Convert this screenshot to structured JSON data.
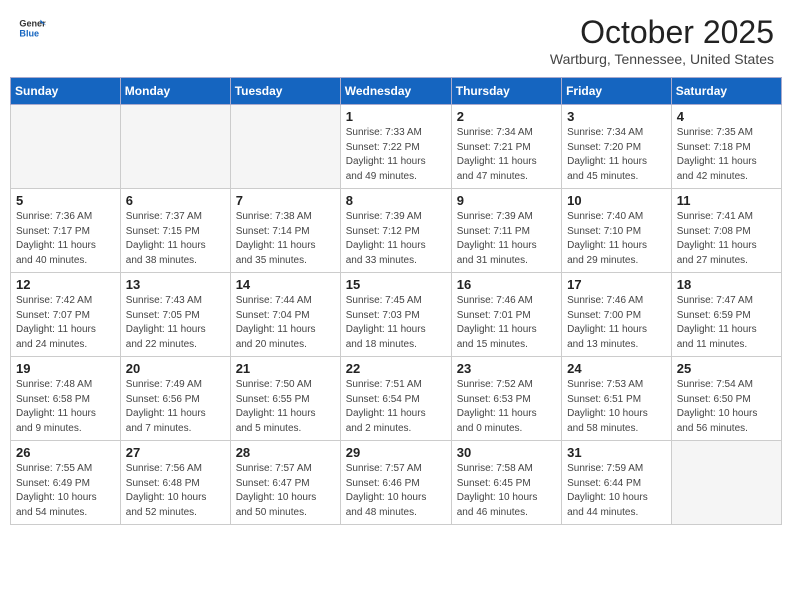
{
  "header": {
    "logo_general": "General",
    "logo_blue": "Blue",
    "title": "October 2025",
    "subtitle": "Wartburg, Tennessee, United States"
  },
  "days_of_week": [
    "Sunday",
    "Monday",
    "Tuesday",
    "Wednesday",
    "Thursday",
    "Friday",
    "Saturday"
  ],
  "weeks": [
    [
      {
        "day": "",
        "info": ""
      },
      {
        "day": "",
        "info": ""
      },
      {
        "day": "",
        "info": ""
      },
      {
        "day": "1",
        "info": "Sunrise: 7:33 AM\nSunset: 7:22 PM\nDaylight: 11 hours\nand 49 minutes."
      },
      {
        "day": "2",
        "info": "Sunrise: 7:34 AM\nSunset: 7:21 PM\nDaylight: 11 hours\nand 47 minutes."
      },
      {
        "day": "3",
        "info": "Sunrise: 7:34 AM\nSunset: 7:20 PM\nDaylight: 11 hours\nand 45 minutes."
      },
      {
        "day": "4",
        "info": "Sunrise: 7:35 AM\nSunset: 7:18 PM\nDaylight: 11 hours\nand 42 minutes."
      }
    ],
    [
      {
        "day": "5",
        "info": "Sunrise: 7:36 AM\nSunset: 7:17 PM\nDaylight: 11 hours\nand 40 minutes."
      },
      {
        "day": "6",
        "info": "Sunrise: 7:37 AM\nSunset: 7:15 PM\nDaylight: 11 hours\nand 38 minutes."
      },
      {
        "day": "7",
        "info": "Sunrise: 7:38 AM\nSunset: 7:14 PM\nDaylight: 11 hours\nand 35 minutes."
      },
      {
        "day": "8",
        "info": "Sunrise: 7:39 AM\nSunset: 7:12 PM\nDaylight: 11 hours\nand 33 minutes."
      },
      {
        "day": "9",
        "info": "Sunrise: 7:39 AM\nSunset: 7:11 PM\nDaylight: 11 hours\nand 31 minutes."
      },
      {
        "day": "10",
        "info": "Sunrise: 7:40 AM\nSunset: 7:10 PM\nDaylight: 11 hours\nand 29 minutes."
      },
      {
        "day": "11",
        "info": "Sunrise: 7:41 AM\nSunset: 7:08 PM\nDaylight: 11 hours\nand 27 minutes."
      }
    ],
    [
      {
        "day": "12",
        "info": "Sunrise: 7:42 AM\nSunset: 7:07 PM\nDaylight: 11 hours\nand 24 minutes."
      },
      {
        "day": "13",
        "info": "Sunrise: 7:43 AM\nSunset: 7:05 PM\nDaylight: 11 hours\nand 22 minutes."
      },
      {
        "day": "14",
        "info": "Sunrise: 7:44 AM\nSunset: 7:04 PM\nDaylight: 11 hours\nand 20 minutes."
      },
      {
        "day": "15",
        "info": "Sunrise: 7:45 AM\nSunset: 7:03 PM\nDaylight: 11 hours\nand 18 minutes."
      },
      {
        "day": "16",
        "info": "Sunrise: 7:46 AM\nSunset: 7:01 PM\nDaylight: 11 hours\nand 15 minutes."
      },
      {
        "day": "17",
        "info": "Sunrise: 7:46 AM\nSunset: 7:00 PM\nDaylight: 11 hours\nand 13 minutes."
      },
      {
        "day": "18",
        "info": "Sunrise: 7:47 AM\nSunset: 6:59 PM\nDaylight: 11 hours\nand 11 minutes."
      }
    ],
    [
      {
        "day": "19",
        "info": "Sunrise: 7:48 AM\nSunset: 6:58 PM\nDaylight: 11 hours\nand 9 minutes."
      },
      {
        "day": "20",
        "info": "Sunrise: 7:49 AM\nSunset: 6:56 PM\nDaylight: 11 hours\nand 7 minutes."
      },
      {
        "day": "21",
        "info": "Sunrise: 7:50 AM\nSunset: 6:55 PM\nDaylight: 11 hours\nand 5 minutes."
      },
      {
        "day": "22",
        "info": "Sunrise: 7:51 AM\nSunset: 6:54 PM\nDaylight: 11 hours\nand 2 minutes."
      },
      {
        "day": "23",
        "info": "Sunrise: 7:52 AM\nSunset: 6:53 PM\nDaylight: 11 hours\nand 0 minutes."
      },
      {
        "day": "24",
        "info": "Sunrise: 7:53 AM\nSunset: 6:51 PM\nDaylight: 10 hours\nand 58 minutes."
      },
      {
        "day": "25",
        "info": "Sunrise: 7:54 AM\nSunset: 6:50 PM\nDaylight: 10 hours\nand 56 minutes."
      }
    ],
    [
      {
        "day": "26",
        "info": "Sunrise: 7:55 AM\nSunset: 6:49 PM\nDaylight: 10 hours\nand 54 minutes."
      },
      {
        "day": "27",
        "info": "Sunrise: 7:56 AM\nSunset: 6:48 PM\nDaylight: 10 hours\nand 52 minutes."
      },
      {
        "day": "28",
        "info": "Sunrise: 7:57 AM\nSunset: 6:47 PM\nDaylight: 10 hours\nand 50 minutes."
      },
      {
        "day": "29",
        "info": "Sunrise: 7:57 AM\nSunset: 6:46 PM\nDaylight: 10 hours\nand 48 minutes."
      },
      {
        "day": "30",
        "info": "Sunrise: 7:58 AM\nSunset: 6:45 PM\nDaylight: 10 hours\nand 46 minutes."
      },
      {
        "day": "31",
        "info": "Sunrise: 7:59 AM\nSunset: 6:44 PM\nDaylight: 10 hours\nand 44 minutes."
      },
      {
        "day": "",
        "info": ""
      }
    ]
  ]
}
